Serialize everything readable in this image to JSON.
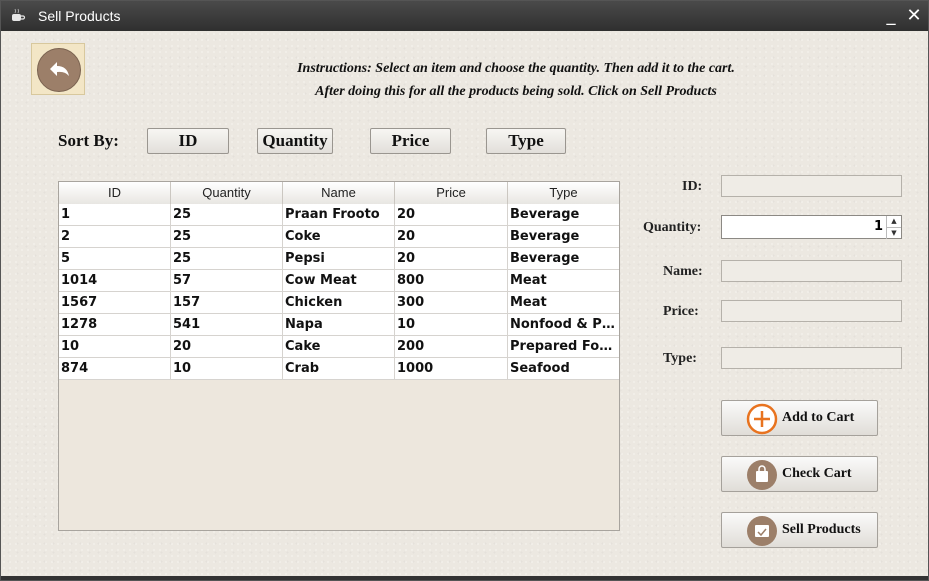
{
  "window": {
    "title": "Sell Products",
    "minimize_glyph": "_",
    "close_glyph": "✕"
  },
  "instructions": {
    "line1": "Instructions: Select an item and choose the quantity. Then add it to the cart.",
    "line2": "After doing this for all the products being sold. Click on Sell Products"
  },
  "sort": {
    "label": "Sort By:",
    "buttons": [
      "ID",
      "Quantity",
      "Price",
      "Type"
    ]
  },
  "table": {
    "columns": [
      "ID",
      "Quantity",
      "Name",
      "Price",
      "Type"
    ],
    "rows": [
      [
        "1",
        "25",
        "Praan Frooto",
        "20",
        "Beverage"
      ],
      [
        "2",
        "25",
        "Coke",
        "20",
        "Beverage"
      ],
      [
        "5",
        "25",
        "Pepsi",
        "20",
        "Beverage"
      ],
      [
        "1014",
        "57",
        "Cow Meat",
        "800",
        "Meat"
      ],
      [
        "1567",
        "157",
        "Chicken",
        "300",
        "Meat"
      ],
      [
        "1278",
        "541",
        "Napa",
        "10",
        "Nonfood & Ph..."
      ],
      [
        "10",
        "20",
        "Cake",
        "200",
        "Prepared Foods"
      ],
      [
        "874",
        "10",
        "Crab",
        "1000",
        "Seafood"
      ]
    ]
  },
  "form": {
    "id_label": "ID:",
    "quantity_label": "Quantity:",
    "quantity_value": "1",
    "name_label": "Name:",
    "price_label": "Price:",
    "type_label": "Type:"
  },
  "actions": {
    "add_to_cart": "Add to Cart",
    "check_cart": "Check Cart",
    "sell_products": "Sell Products"
  },
  "icons": {
    "title": "coffee-cup-icon",
    "back": "back-arrow-icon",
    "add": "plus-circle-icon",
    "cart": "shopping-bag-icon",
    "sell": "receipt-icon"
  },
  "colors": {
    "accent_orange": "#e8731f",
    "icon_brown": "#9c7f69",
    "titlebar": "#3a3a3a"
  }
}
